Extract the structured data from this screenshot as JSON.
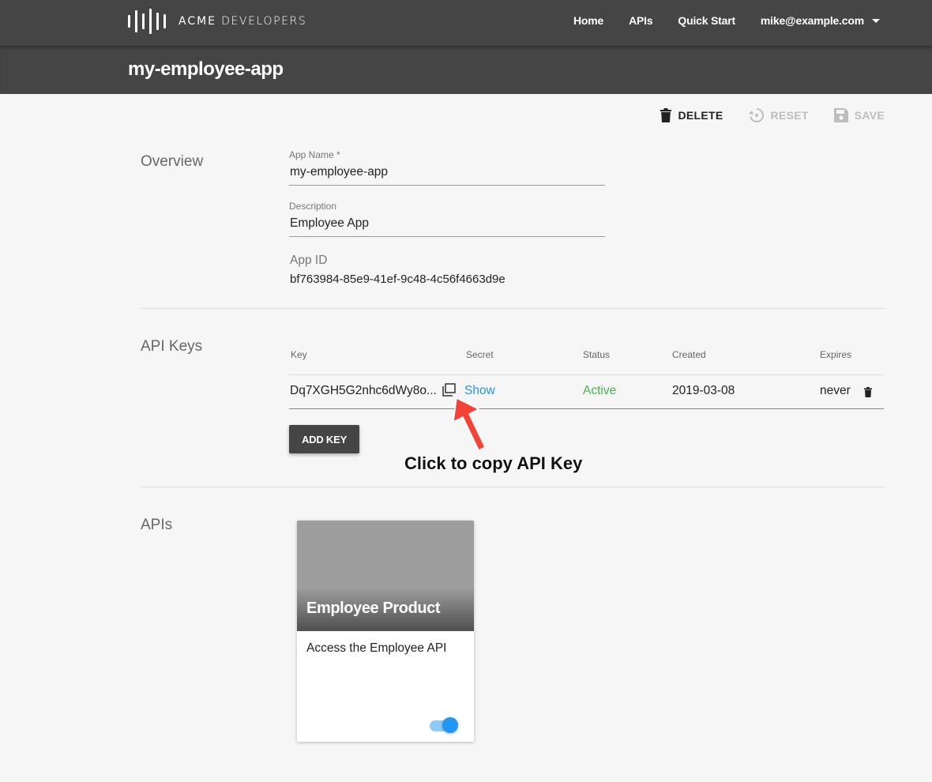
{
  "header": {
    "brand_a": "ACME",
    "brand_b": "DEVELOPERS",
    "nav": [
      "Home",
      "APIs",
      "Quick Start"
    ],
    "user": "mike@example.com"
  },
  "page": {
    "title": "my-employee-app"
  },
  "actions": {
    "delete": "DELETE",
    "reset": "RESET",
    "save": "SAVE"
  },
  "overview": {
    "section": "Overview",
    "app_name_label": "App Name *",
    "app_name": "my-employee-app",
    "description_label": "Description",
    "description": "Employee App",
    "app_id_label": "App ID",
    "app_id": "bf763984-85e9-41ef-9c48-4c56f4663d9e"
  },
  "api_keys": {
    "section": "API Keys",
    "columns": [
      "Key",
      "Secret",
      "Status",
      "Created",
      "Expires"
    ],
    "rows": [
      {
        "key": "Dq7XGH5G2nhc6dWy8o...",
        "secret": "Show",
        "status": "Active",
        "created": "2019-03-08",
        "expires": "never"
      }
    ],
    "add_key": "ADD KEY"
  },
  "annotation": "Click to copy API Key",
  "apis": {
    "section": "APIs",
    "cards": [
      {
        "title": "Employee Product",
        "description": "Access the Employee API",
        "enabled": true
      }
    ]
  },
  "colors": {
    "header_bg": "#454545",
    "link": "#2196f3",
    "active": "#4caf50",
    "arrow": "#f44336"
  },
  "icons": [
    "trash-icon",
    "reset-icon",
    "save-icon",
    "copy-icon",
    "caret-down-icon",
    "logo-bars-icon",
    "arrow-annotation"
  ]
}
